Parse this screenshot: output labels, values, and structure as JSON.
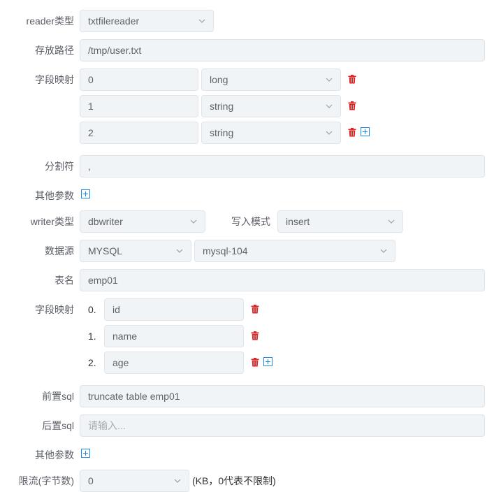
{
  "reader": {
    "type_label": "reader类型",
    "type_value": "txtfilereader",
    "path_label": "存放路径",
    "path_value": "/tmp/user.txt",
    "mapping_label": "字段映射",
    "mappings": [
      {
        "index": "0",
        "type": "long"
      },
      {
        "index": "1",
        "type": "string"
      },
      {
        "index": "2",
        "type": "string"
      }
    ],
    "delimiter_label": "分割符",
    "delimiter_value": ",",
    "other_params_label": "其他参数"
  },
  "writer": {
    "type_label": "writer类型",
    "type_value": "dbwriter",
    "mode_label": "写入模式",
    "mode_value": "insert",
    "datasource_label": "数据源",
    "db_type_value": "MYSQL",
    "datasource_value": "mysql-104",
    "table_label": "表名",
    "table_value": "emp01",
    "mapping_label": "字段映射",
    "columns": [
      {
        "index": "0.",
        "name": "id"
      },
      {
        "index": "1.",
        "name": "name"
      },
      {
        "index": "2.",
        "name": "age"
      }
    ],
    "pre_sql_label": "前置sql",
    "pre_sql_value": "truncate table emp01",
    "post_sql_label": "后置sql",
    "post_sql_placeholder": "请输入...",
    "other_params_label": "其他参数"
  },
  "throttle": {
    "label": "限流(字节数)",
    "value": "0",
    "note": "(KB，0代表不限制)"
  },
  "colors": {
    "danger": "#e02424",
    "primary": "#1e88e5",
    "input_bg": "#f0f4f7",
    "border": "#dfe4ea"
  },
  "icons": {
    "delete": "trash-icon",
    "add": "plus-square-icon",
    "dropdown": "chevron-down-icon"
  }
}
